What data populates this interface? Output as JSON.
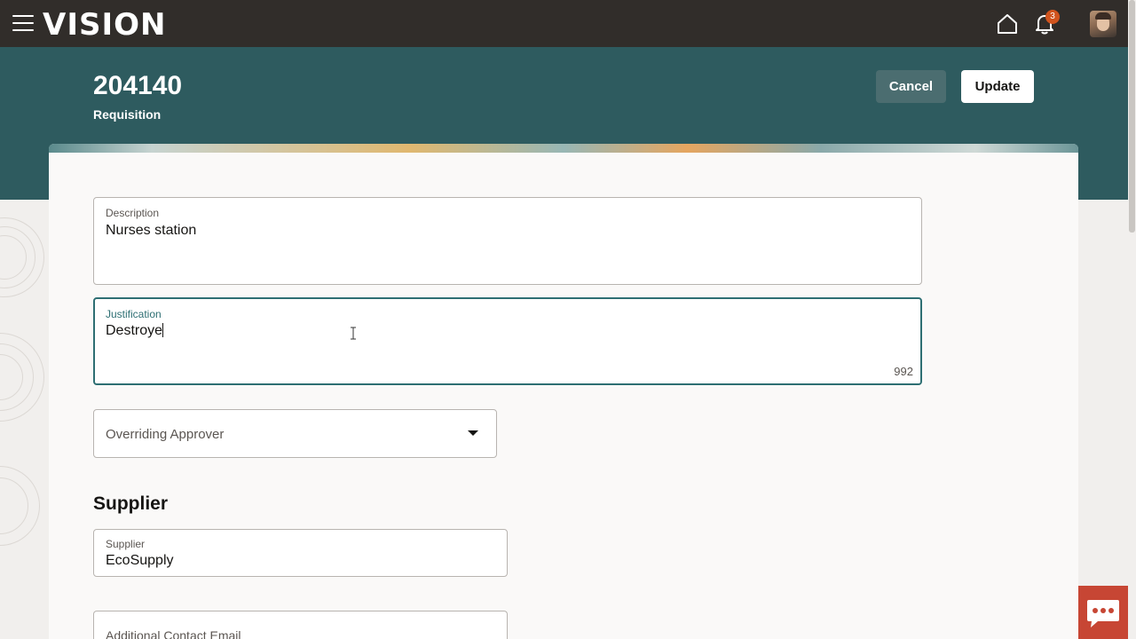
{
  "app": {
    "brand": "VISION",
    "notification_count": "3"
  },
  "header": {
    "requisition_number": "204140",
    "requisition_label": "Requisition",
    "cancel_label": "Cancel",
    "update_label": "Update"
  },
  "form": {
    "description": {
      "label": "Description",
      "value": "Nurses station"
    },
    "justification": {
      "label": "Justification",
      "value": "Destroye",
      "remaining_chars": "992"
    },
    "overriding_approver": {
      "placeholder": "Overriding Approver"
    },
    "supplier_section_title": "Supplier",
    "supplier": {
      "label": "Supplier",
      "value": "EcoSupply"
    },
    "additional_contact_email": {
      "label": "Additional Contact Email"
    }
  },
  "icons": {
    "menu": "hamburger-menu-icon",
    "home": "home-icon",
    "notifications": "bell-icon",
    "chat": "chat-icon"
  },
  "colors": {
    "topbar": "#312d2a",
    "header_band": "#2e5b5f",
    "focus": "#2e6f73",
    "badge": "#d1541e",
    "chat": "#c74634"
  }
}
